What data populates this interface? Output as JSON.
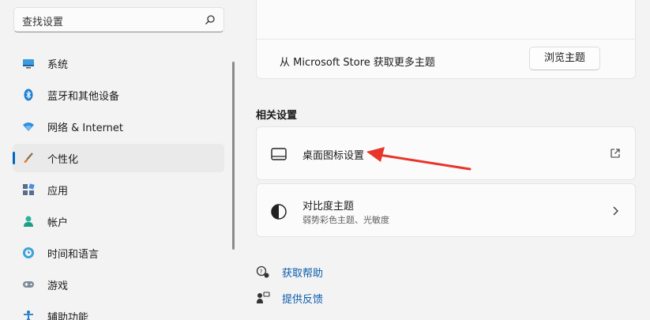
{
  "search": {
    "placeholder": "查找设置",
    "icon": "search-icon"
  },
  "sidebar": {
    "items": [
      {
        "label": "系统",
        "icon": "monitor-icon",
        "active": false
      },
      {
        "label": "蓝牙和其他设备",
        "icon": "bluetooth-icon",
        "active": false
      },
      {
        "label": "网络 & Internet",
        "icon": "wifi-icon",
        "active": false
      },
      {
        "label": "个性化",
        "icon": "brush-icon",
        "active": true
      },
      {
        "label": "应用",
        "icon": "apps-icon",
        "active": false
      },
      {
        "label": "帐户",
        "icon": "person-icon",
        "active": false
      },
      {
        "label": "时间和语言",
        "icon": "clock-globe-icon",
        "active": false
      },
      {
        "label": "游戏",
        "icon": "gamepad-icon",
        "active": false
      },
      {
        "label": "辅助功能",
        "icon": "accessibility-icon",
        "active": false
      }
    ]
  },
  "themes": {
    "store_text": "从 Microsoft Store 获取更多主题",
    "browse_button": "浏览主题"
  },
  "related": {
    "title": "相关设置",
    "desktop_icons": {
      "title": "桌面图标设置",
      "icon": "desktop-icon",
      "trailing": "open-external-icon"
    },
    "contrast": {
      "title": "对比度主题",
      "subtitle": "弱势彩色主题、光敏度",
      "icon": "contrast-icon",
      "trailing": "chevron-right-icon"
    }
  },
  "links": {
    "help": "获取帮助",
    "feedback": "提供反馈"
  },
  "colors": {
    "accent": "#0067c0",
    "annotation_arrow": "#e8352b"
  }
}
